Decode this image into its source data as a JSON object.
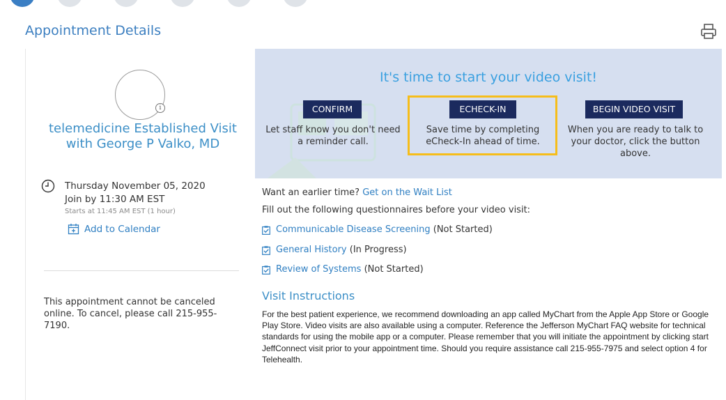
{
  "page": {
    "title": "Appointment Details"
  },
  "appointment": {
    "title": "telemedicine Established Visit with George P Valko, MD",
    "date": "Thursday November 05, 2020",
    "join_by": "Join by 11:30 AM EST",
    "starts_at": "Starts at 11:45 AM EST (1 hour)",
    "add_to_calendar": "Add to Calendar",
    "cancel_notice": "This appointment cannot be canceled online. To cancel, please call 215-955-7190."
  },
  "banner": {
    "title": "It's time to start your video visit!",
    "actions": [
      {
        "label": "CONFIRM",
        "description": "Let staff know you don't need a reminder call."
      },
      {
        "label": "ECHECK-IN",
        "description": "Save time by completing eCheck-In ahead of time."
      },
      {
        "label": "BEGIN VIDEO VISIT",
        "description": "When you are ready to talk to your doctor, click the button above."
      }
    ],
    "highlight_color": "#f6bd1a",
    "button_color": "#1b2a5e",
    "background_color": "#d6dff0"
  },
  "waitlist": {
    "prompt": "Want an earlier time?",
    "link": "Get on the Wait List"
  },
  "questionnaires": {
    "intro": "Fill out the following questionnaires before your video visit:",
    "items": [
      {
        "label": "Communicable Disease Screening",
        "status": "(Not Started)"
      },
      {
        "label": "General History",
        "status": "(In Progress)"
      },
      {
        "label": "Review of Systems",
        "status": "(Not Started)"
      }
    ]
  },
  "instructions": {
    "title": "Visit Instructions",
    "body": "For the best patient experience, we recommend downloading an app called MyChart from the Apple App Store or Google Play Store. Video visits are also available using a computer. Reference the Jefferson MyChart FAQ website for technical standards for using the mobile app or a computer. Please remember that you will initiate the appointment by clicking start JeffConnect visit prior to your appointment time. Should you require assistance call 215-955-7975 and select option 4 for Telehealth."
  },
  "icons": {
    "print": "printer-icon",
    "info": "info-icon",
    "clock": "clock-icon",
    "calendar": "calendar-add-icon",
    "questionnaire": "clipboard-check-icon"
  },
  "colors": {
    "accent": "#3c8fc7",
    "link": "#2f7fc2"
  }
}
